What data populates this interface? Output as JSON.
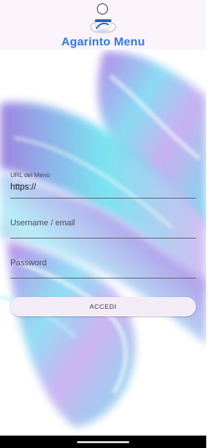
{
  "app": {
    "title": "Agarinto Menu",
    "logo_icon": "chef-hat-logo-icon"
  },
  "form": {
    "url_label": "URL del Menù",
    "url_value": "https://",
    "username_placeholder": "Username / email",
    "password_placeholder": "Password",
    "login_button": "ACCEDI"
  },
  "colors": {
    "title": "#2f7be8",
    "header_bg": "#fbf3fa",
    "button_bg": "#f3ecf6",
    "accent_purple": "#9b7ee0",
    "accent_cyan": "#6fe3f0"
  },
  "system": {
    "camera_icon": "front-camera-icon",
    "nav_handle": "gesture-nav-handle"
  }
}
